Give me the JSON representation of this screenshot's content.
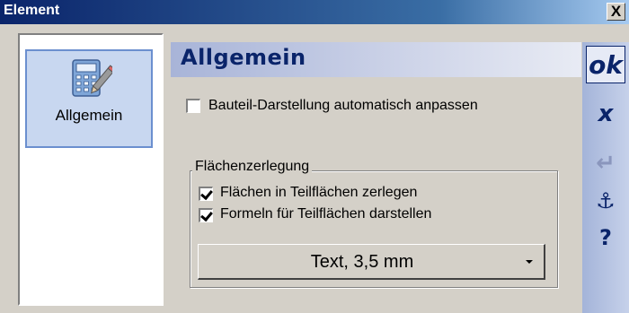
{
  "window": {
    "title": "Element",
    "close_label": "X"
  },
  "sidebar": {
    "items": [
      {
        "label": "Allgemein",
        "icon": "calculator-pencil-icon"
      }
    ]
  },
  "main": {
    "title": "Allgemein",
    "auto_adjust": {
      "label": "Bauteil-Darstellung automatisch anpassen",
      "checked": false
    },
    "group": {
      "legend": "Flächenzerlegung",
      "split_faces": {
        "label": "Flächen in Teilflächen zerlegen",
        "checked": true
      },
      "show_formulas": {
        "label": "Formeln für Teilflächen darstellen",
        "checked": true
      },
      "text_style": {
        "value": "Text, 3,5 mm"
      }
    }
  },
  "toolbar": {
    "ok_label": "ok",
    "cancel_label": "x",
    "enter_label": "↵",
    "anchor_label": "⚓",
    "help_label": "?"
  },
  "colors": {
    "accent": "#0a246a",
    "selection": "#c8d7f0",
    "face": "#d4d0c8"
  }
}
